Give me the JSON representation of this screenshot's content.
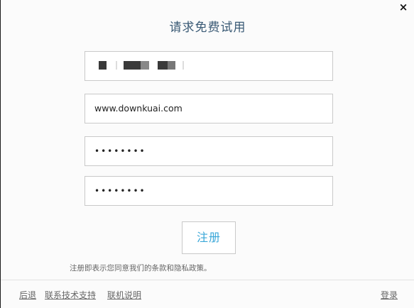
{
  "dialog": {
    "title": "请求免费试用",
    "close_glyph": "×"
  },
  "form": {
    "name_value": "",
    "url_value": "www.downkuai.com",
    "password_value": "••••••••",
    "password_confirm_value": "••••••••",
    "register_label": "注册"
  },
  "terms_text": "注册即表示您同意我们的条款和隐私政策。",
  "footer": {
    "back_label": "后退",
    "support_label": "联系技术支持",
    "help_label": "联机说明",
    "login_label": "登录"
  }
}
